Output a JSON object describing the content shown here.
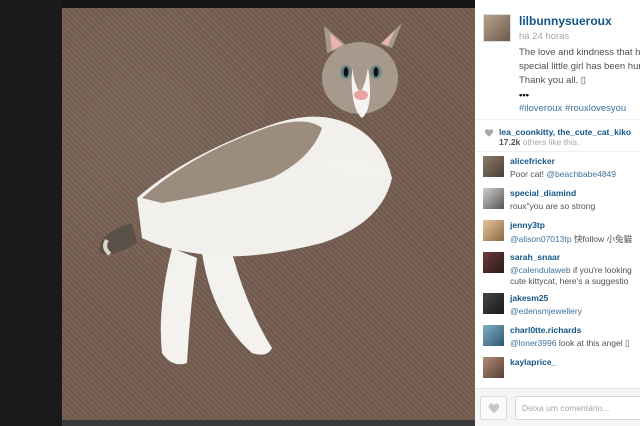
{
  "post": {
    "author": "lilbunnysueroux",
    "time": "há 24 horas",
    "caption_lines": [
      "The love and kindness that ha",
      "special little girl has been hum",
      "Thank you all. ▯"
    ],
    "ellipsis": "•••",
    "hashtags": "#iloveroux #rouxlovesyou"
  },
  "likes": {
    "likers": "lea_coonkitty, the_cute_cat_kiko",
    "count": "17.2k",
    "suffix": " others like this."
  },
  "comments": [
    {
      "user": "alicefricker",
      "text": "Poor cat! ",
      "mention": "@beachbabe4849",
      "tail": ""
    },
    {
      "user": "special_diamind",
      "text": "roux\"you are so strong",
      "mention": "",
      "tail": ""
    },
    {
      "user": "jenny3tp",
      "text": "",
      "mention": "@alison07013tp",
      "tail": " 快follow 小兔貓"
    },
    {
      "user": "sarah_snaar",
      "text": "",
      "mention": "@calendulaweb",
      "tail": " if you're looking",
      "line2": "cute kittycat, here's a suggestio"
    },
    {
      "user": "jakesm25",
      "text": "",
      "mention": "@edensmjewellery",
      "tail": ""
    },
    {
      "user": "charl0tte.richards",
      "text": "",
      "mention": "@loner3996",
      "tail": " look at this angel ▯"
    },
    {
      "user": "kaylaprice_",
      "text": "",
      "mention": "",
      "tail": ""
    }
  ],
  "footer": {
    "placeholder": "Deixa um comentário..."
  },
  "colors": {
    "link": "#125688",
    "hashtag": "#3f729b",
    "muted": "#a5a7aa"
  },
  "icons": [
    "heart-icon"
  ]
}
